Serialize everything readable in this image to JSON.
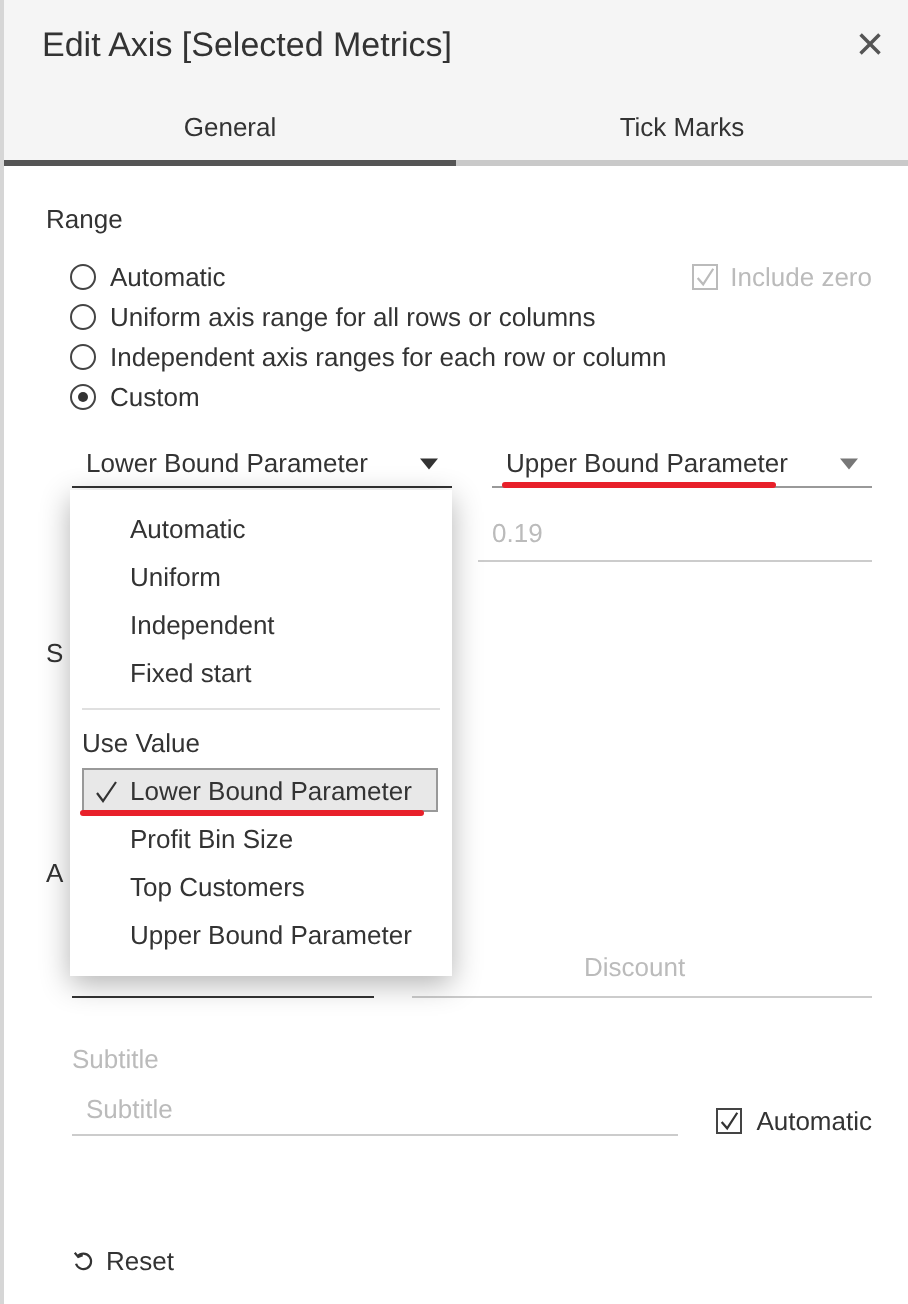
{
  "window": {
    "title": "Edit Axis [Selected Metrics]",
    "close": "×"
  },
  "tabs": [
    {
      "label": "General",
      "selected": true
    },
    {
      "label": "Tick Marks",
      "selected": false
    }
  ],
  "range": {
    "label": "Range",
    "options": [
      {
        "label": "Automatic",
        "selected": false
      },
      {
        "label": "Uniform axis range for all rows or columns",
        "selected": false
      },
      {
        "label": "Independent axis ranges for each row or column",
        "selected": false
      },
      {
        "label": "Custom",
        "selected": true
      }
    ],
    "include_zero": {
      "label": "Include zero",
      "checked": true,
      "disabled": true
    },
    "lower_dropdown": {
      "value": "Lower Bound Parameter"
    },
    "upper_dropdown": {
      "value": "Upper Bound Parameter",
      "annotated": true
    },
    "upper_value": {
      "placeholder": "0.19"
    }
  },
  "dropdown_menu": {
    "items": [
      {
        "kind": "option",
        "label": "Automatic",
        "selected": false,
        "annotated": false
      },
      {
        "kind": "option",
        "label": "Uniform",
        "selected": false,
        "annotated": false
      },
      {
        "kind": "option",
        "label": "Independent",
        "selected": false,
        "annotated": false
      },
      {
        "kind": "option",
        "label": "Fixed start",
        "selected": false,
        "annotated": false
      },
      {
        "kind": "divider"
      },
      {
        "kind": "heading",
        "label": "Use Value"
      },
      {
        "kind": "option",
        "label": "Lower Bound Parameter",
        "selected": true,
        "annotated": true
      },
      {
        "kind": "option",
        "label": "Profit Bin Size",
        "selected": false,
        "annotated": false
      },
      {
        "kind": "option",
        "label": "Top Customers",
        "selected": false,
        "annotated": false
      },
      {
        "kind": "option",
        "label": "Upper Bound Parameter",
        "selected": false,
        "annotated": false
      }
    ]
  },
  "scale": {
    "label": "S"
  },
  "axis_titles": {
    "label": "A",
    "title_value": "Discount"
  },
  "subtitle": {
    "label": "Subtitle",
    "placeholder": "Subtitle",
    "automatic": {
      "label": "Automatic",
      "checked": true
    }
  },
  "reset": {
    "label": "Reset"
  }
}
